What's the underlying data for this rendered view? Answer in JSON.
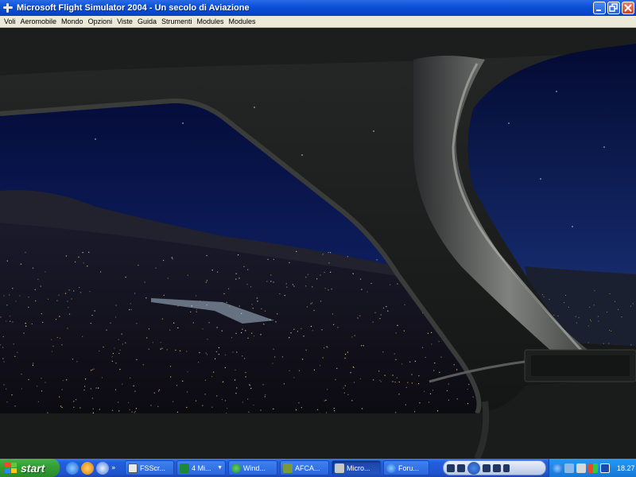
{
  "window": {
    "title": "Microsoft Flight Simulator 2004 - Un secolo di Aviazione"
  },
  "menu": [
    "Voli",
    "Aeromobile",
    "Mondo",
    "Opzioni",
    "Viste",
    "Guida",
    "Strumenti",
    "Modules",
    "Modules"
  ],
  "taskbar": {
    "start_label": "start",
    "quicklaunch_more": "»",
    "tasks": [
      {
        "label": "FSScr...",
        "icon": "fsscreenshot-icon",
        "grouped": false,
        "active": false
      },
      {
        "label": "4 Mi...",
        "icon": "excel-icon",
        "grouped": true,
        "active": false
      },
      {
        "label": "Wind...",
        "icon": "windows-messenger-icon",
        "grouped": false,
        "active": false
      },
      {
        "label": "AFCA...",
        "icon": "afcad-icon",
        "grouped": false,
        "active": false
      },
      {
        "label": "Micro...",
        "icon": "flight-simulator-icon",
        "grouped": false,
        "active": true
      },
      {
        "label": "Foru...",
        "icon": "internet-explorer-icon",
        "grouped": false,
        "active": false
      }
    ],
    "clock": "18.27"
  },
  "colors": {
    "title_bar": "#0a4fd6",
    "menu_bg": "#ece9d8",
    "taskbar": "#245edc",
    "start_green": "#34a034",
    "tray": "#1478d8"
  }
}
